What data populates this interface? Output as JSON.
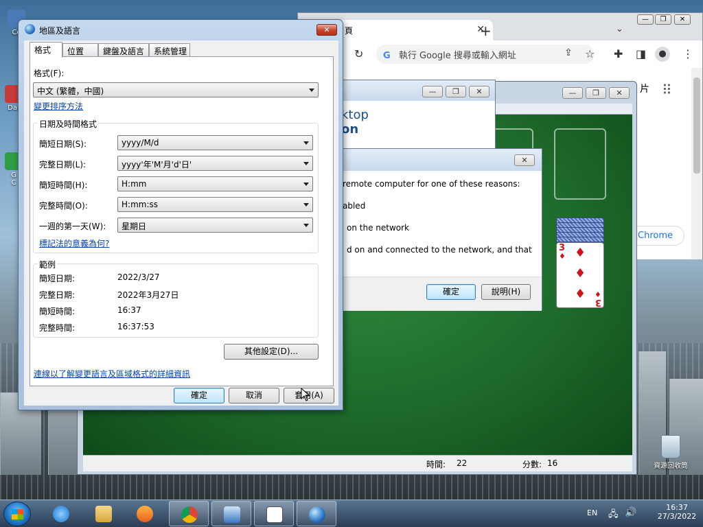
{
  "desktop": {
    "icons": [
      {
        "label": "Co",
        "color": "#4a7bb8"
      },
      {
        "label": "Dat",
        "color": "#c73b3b"
      },
      {
        "label": "G",
        "color": "#2f9e44"
      },
      {
        "label": "C",
        "color": "#e0e0e0"
      }
    ],
    "recycle_bin": "資源回收筒"
  },
  "chrome": {
    "tab_title": "頁",
    "omnibox_placeholder": "執行 Google 搜尋或輸入網址",
    "shortcut_pill": "Chrome",
    "side_glyph": "片",
    "controls": {
      "minimize": "—",
      "maximize": "❐",
      "close": "✕"
    }
  },
  "solitaire": {
    "status": {
      "time_label": "時間:",
      "time_value": "22",
      "score_label": "分數:",
      "score_value": "16"
    },
    "card": {
      "rank": "3",
      "suit": "♦"
    }
  },
  "rdp": {
    "banner_line1": "ktop",
    "banner_line2": "on",
    "message_lines": [
      "remote computer for one of these reasons:",
      "abled",
      "on the network",
      "d on and connected to the network, and that"
    ],
    "ok": "確定",
    "help": "說明(H)"
  },
  "region": {
    "title": "地區及語言",
    "tabs": [
      "格式",
      "位置",
      "鍵盤及語言",
      "系統管理"
    ],
    "format_label": "格式(F):",
    "format_value": "中文 (繁體，中國)",
    "sort_link": "變更排序方法",
    "datetime_group": "日期及時間格式",
    "fields": [
      {
        "label": "簡短日期(S):",
        "value": "yyyy/M/d"
      },
      {
        "label": "完整日期(L):",
        "value": "yyyy'年'M'月'd'日'"
      },
      {
        "label": "簡短時間(H):",
        "value": "H:mm"
      },
      {
        "label": "完整時間(O):",
        "value": "H:mm:ss"
      },
      {
        "label": "一週的第一天(W):",
        "value": "星期日"
      }
    ],
    "notation_link": "標記法的意義為何?",
    "example_group": "範例",
    "examples": [
      {
        "label": "簡短日期:",
        "value": "2022/3/27"
      },
      {
        "label": "完整日期:",
        "value": "2022年3月27日"
      },
      {
        "label": "簡短時間:",
        "value": "16:37"
      },
      {
        "label": "完整時間:",
        "value": "16:37:53"
      }
    ],
    "other_settings": "其他設定(D)...",
    "info_link": "連線以了解變更語言及區域格式的詳細資訊",
    "ok": "確定",
    "cancel": "取消",
    "apply": "套用(A)"
  },
  "taskbar": {
    "lang": "EN",
    "time": "16:37",
    "date": "27/3/2022"
  }
}
